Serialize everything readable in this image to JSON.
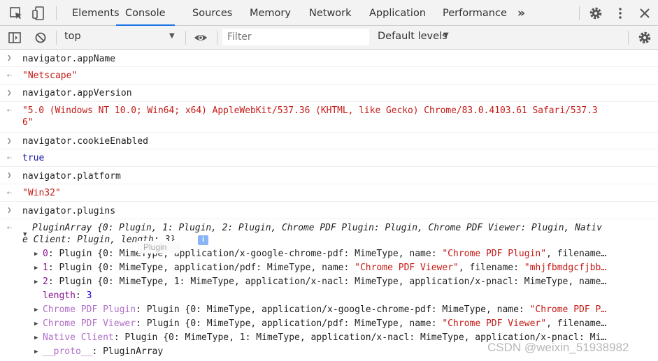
{
  "tabs": [
    {
      "label": "Elements"
    },
    {
      "label": "Console"
    },
    {
      "label": "Sources"
    },
    {
      "label": "Memory"
    },
    {
      "label": "Network"
    },
    {
      "label": "Application"
    },
    {
      "label": "Performance"
    }
  ],
  "toolbar": {
    "context": "top",
    "filter_placeholder": "Filter",
    "levels": "Default levels"
  },
  "console": {
    "entries": [
      {
        "input": "navigator.appName",
        "output": "\"Netscape\""
      },
      {
        "input": "navigator.appVersion",
        "output_line1": "\"5.0 (Windows NT 10.0; Win64; x64) AppleWebKit/537.36 (KHTML, like Gecko) Chrome/83.0.4103.61 Safari/537.3",
        "output_line2": "6\""
      },
      {
        "input": "navigator.cookieEnabled",
        "output": "true"
      },
      {
        "input": "navigator.platform",
        "output": "\"Win32\""
      },
      {
        "input": "navigator.plugins"
      }
    ],
    "plugin_array": {
      "summary_line1": "PluginArray {0: Plugin, 1: Plugin, 2: Plugin, Chrome PDF Plugin: Plugin, Chrome PDF Viewer: Plugin, Nativ",
      "summary_line2": "e Client: Plugin, length: 3}",
      "tooltip": "Plugin",
      "props": [
        {
          "key": "0",
          "rest": ": Plugin {0: MimeType, application/x-google-chrome-pdf: MimeType, name: ",
          "str": "\"Chrome PDF Plugin\"",
          "tail": ", filename…"
        },
        {
          "key": "1",
          "rest": ": Plugin {0: MimeType, application/pdf: MimeType, name: ",
          "str": "\"Chrome PDF Viewer\"",
          "tail": ", filename: ",
          "str2": "\"mhjfbmdgcfjbb…"
        },
        {
          "key": "2",
          "rest": ": Plugin {0: MimeType, 1: MimeType, application/x-nacl: MimeType, application/x-pnacl: MimeType, name…",
          "str": "",
          "tail": ""
        }
      ],
      "length_key": "length",
      "length_val": "3",
      "named": [
        {
          "key": "Chrome PDF Plugin",
          "rest": ": Plugin {0: MimeType, application/x-google-chrome-pdf: MimeType, name: ",
          "str": "\"Chrome PDF P…"
        },
        {
          "key": "Chrome PDF Viewer",
          "rest": ": Plugin {0: MimeType, application/pdf: MimeType, name: ",
          "str": "\"Chrome PDF Viewer\"",
          "tail": ", filename…"
        },
        {
          "key": "Native Client",
          "rest": ": Plugin {0: MimeType, 1: MimeType, application/x-nacl: MimeType, application/x-pnacl: Mi…"
        }
      ],
      "proto_key": "__proto__",
      "proto_val": ": PluginArray"
    }
  },
  "watermark": "CSDN @weixin_51938982"
}
